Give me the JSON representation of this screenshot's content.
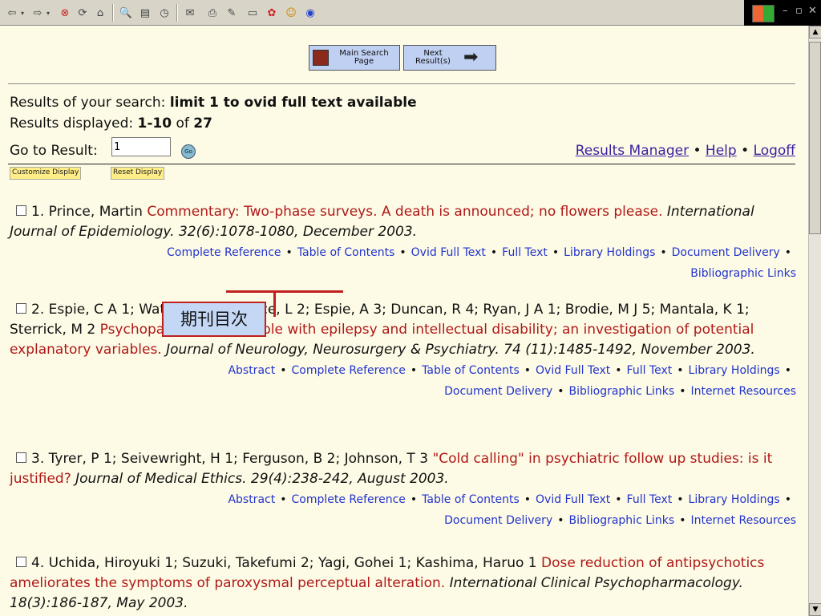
{
  "browser": {
    "toolbar_icons": [
      "back-icon",
      "dropdown-icon",
      "forward-icon",
      "dropdown-icon",
      "stop-icon",
      "refresh-icon",
      "home-icon",
      "search-icon",
      "favorites-icon",
      "history-icon",
      "mail-icon",
      "print-icon",
      "edit-icon",
      "discuss-icon",
      "messenger-icon",
      "smiley-icon",
      "media-icon"
    ],
    "window_controls": [
      "–",
      "🗗",
      "✕"
    ]
  },
  "nav": {
    "main_search_label": "Main Search Page",
    "next_results_label": "Next Result(s)"
  },
  "search": {
    "results_of_label": "Results of your search:",
    "query": "limit 1 to ovid full text available",
    "displayed_label": "Results displayed:",
    "displayed_range": "1-10",
    "of_label": "of",
    "total": "27",
    "goto_label": "Go to Result:",
    "goto_value": "1",
    "go_button": "Go"
  },
  "top_links": {
    "results_manager": "Results Manager",
    "help": "Help",
    "logoff": "Logoff"
  },
  "display_buttons": {
    "customize": "Customize Display",
    "reset": "Reset Display"
  },
  "callout": {
    "text": "期刊目次"
  },
  "records": [
    {
      "number": "1.",
      "authors": "Prince, Martin",
      "title": "Commentary: Two-phase surveys. A death is announced; no flowers please.",
      "journal": "International Journal of Epidemiology. 32(6):1078-1080, December 2003.",
      "links_line1": [
        "Complete Reference",
        "Table of Contents",
        "Ovid Full Text",
        "Full Text",
        "Library Holdings",
        "Document Delivery"
      ],
      "links_line2": [
        "Bibliographic Links"
      ]
    },
    {
      "number": "2.",
      "authors": "Espie, C A 1; Watkins, J 2; Curtice, L 2; Espie, A 3; Duncan, R 4; Ryan, J A 1; Brodie, M J 5; Mantala, K 1; Sterrick, M 2",
      "title": "Psychopathology in people with epilepsy and intellectual disability; an investigation of potential explanatory variables.",
      "journal": "Journal of Neurology, Neurosurgery & Psychiatry. 74 (11):1485-1492, November 2003.",
      "links_line1": [
        "Abstract",
        "Complete Reference",
        "Table of Contents",
        "Ovid Full Text",
        "Full Text",
        "Library Holdings"
      ],
      "links_line2": [
        "Document Delivery",
        "Bibliographic Links",
        "Internet Resources"
      ]
    },
    {
      "number": "3.",
      "authors": "Tyrer, P 1; Seivewright, H 1; Ferguson, B 2; Johnson, T 3",
      "title": "\"Cold calling\" in psychiatric follow up studies: is it justified?",
      "journal": "Journal of Medical Ethics. 29(4):238-242, August 2003.",
      "links_line1": [
        "Abstract",
        "Complete Reference",
        "Table of Contents",
        "Ovid Full Text",
        "Full Text",
        "Library Holdings"
      ],
      "links_line2": [
        "Document Delivery",
        "Bibliographic Links",
        "Internet Resources"
      ]
    },
    {
      "number": "4.",
      "authors": "Uchida, Hiroyuki 1; Suzuki, Takefumi 2; Yagi, Gohei 1; Kashima, Haruo 1",
      "title": "Dose reduction of antipsychotics ameliorates the symptoms of paroxysmal perceptual alteration.",
      "journal": "International Clinical Psychopharmacology. 18(3):186-187, May 2003.",
      "links_line1": [],
      "links_line2": []
    }
  ]
}
